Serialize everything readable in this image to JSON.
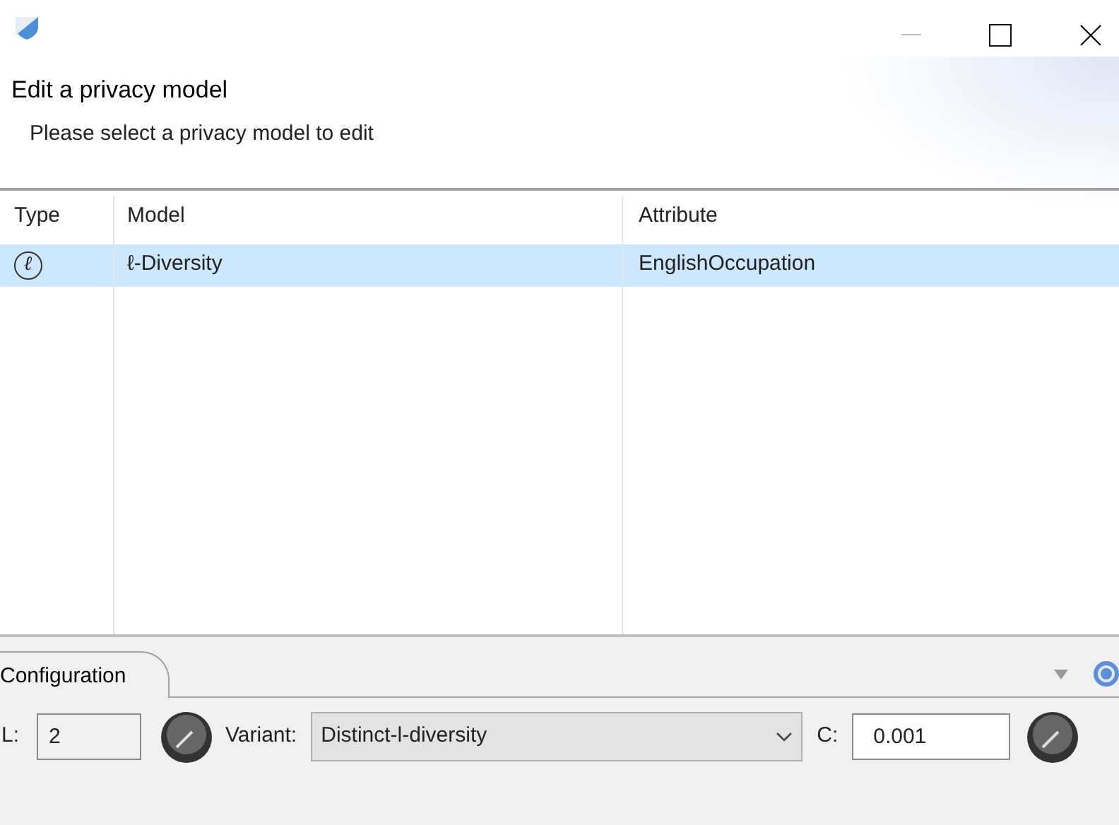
{
  "dialog": {
    "heading": "Edit a privacy model",
    "subtitle": "Please select a privacy model to edit"
  },
  "table": {
    "columns": [
      "Type",
      "Model",
      "Attribute"
    ],
    "rows": [
      {
        "type_symbol": "ℓ",
        "model": "ℓ-Diversity",
        "attribute": "EnglishOccupation",
        "selected": true
      }
    ]
  },
  "configuration": {
    "tab": "Configuration",
    "l_label": "L:",
    "l_value": "2",
    "variant_label": "Variant:",
    "variant_value": "Distinct-l-diversity",
    "c_label": "C:",
    "c_value": "0.001"
  }
}
